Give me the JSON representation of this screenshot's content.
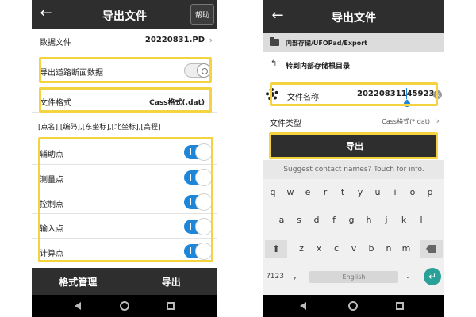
{
  "left": {
    "title": "导出文件",
    "help": "帮助",
    "back_icon": "arrow-left-icon",
    "data_file_label": "数据文件",
    "data_file_value": "20220831.PD",
    "road_section_label": "导出道路断面数据",
    "road_section_toggle": "off",
    "file_format_label": "文件格式",
    "file_format_value": "Cass格式(.dat)",
    "field_order": "[点名],[编码],[东坐标],[北坐标],[高程]",
    "point_types": [
      {
        "label": "辅助点",
        "on": true
      },
      {
        "label": "测量点",
        "on": true
      },
      {
        "label": "控制点",
        "on": true
      },
      {
        "label": "输入点",
        "on": true
      },
      {
        "label": "计算点",
        "on": true
      }
    ],
    "format_manage": "格式管理",
    "export": "导出",
    "highlight_color": "#f5d340",
    "toggle_on_color": "#1e86d8"
  },
  "right": {
    "title": "导出文件",
    "back_icon": "arrow-left-icon",
    "path": "内部存储/UFOPad/Export",
    "goto_root": "转到内部存储根目录",
    "file_name_label": "文件名称",
    "file_name_value": "20220831145923",
    "file_type_label": "文件类型",
    "file_type_value": "Cass格式(*.dat)",
    "export": "导出",
    "suggestion": "Suggest contact names? Touch for info.",
    "keys_row1": [
      "q",
      "w",
      "e",
      "r",
      "t",
      "y",
      "u",
      "i",
      "o",
      "p"
    ],
    "keys_row2": [
      "a",
      "s",
      "d",
      "f",
      "g",
      "h",
      "j",
      "k",
      "l"
    ],
    "keys_row3": [
      "z",
      "x",
      "c",
      "v",
      "b",
      "n",
      "m"
    ],
    "sym_key": "?123",
    "comma_key": ",",
    "space_key": "English",
    "dot_key": ".",
    "enter_icon": "enter-icon",
    "accent_color": "#2aa198"
  }
}
